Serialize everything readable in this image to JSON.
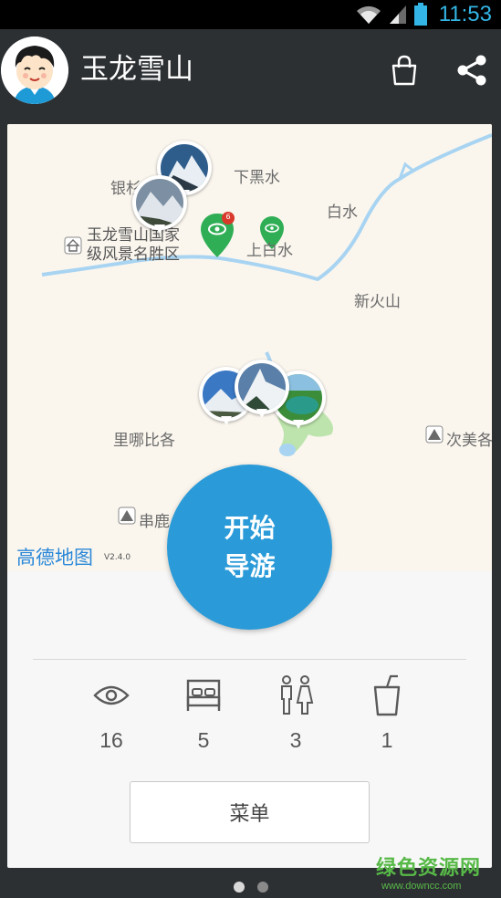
{
  "status_bar": {
    "time": "11:53"
  },
  "header": {
    "title": "玉龙雪山"
  },
  "map": {
    "labels": {
      "yinhe": "银杉",
      "xiaheishui": "下黑水",
      "baishui": "白水",
      "shangbaishui": "上白水",
      "xinhuoshan": "新火山",
      "linabige": "里哪比各",
      "cimeige": "次美各",
      "chuanlu": "串鹿",
      "poi_line1": "玉龙雪山国家",
      "poi_line2": "级风景名胜区"
    },
    "badge_count": "6",
    "logo": "高德地图",
    "version": "V2.4.0"
  },
  "start_button": {
    "line1": "开始",
    "line2": "导游"
  },
  "stats": [
    {
      "icon": "eye-icon",
      "value": "16"
    },
    {
      "icon": "bed-icon",
      "value": "5"
    },
    {
      "icon": "restroom-icon",
      "value": "3"
    },
    {
      "icon": "drink-cup-icon",
      "value": "1"
    }
  ],
  "menu_button": {
    "label": "菜单"
  },
  "pager": {
    "pages": 2,
    "current": 1
  },
  "watermark": {
    "text": "绿色资源网",
    "url": "www.downcc.com"
  },
  "colors": {
    "accent": "#2a9bd8",
    "pin_green": "#2fae55",
    "river": "#a8d4f2",
    "lake": "#b9e3a8"
  }
}
